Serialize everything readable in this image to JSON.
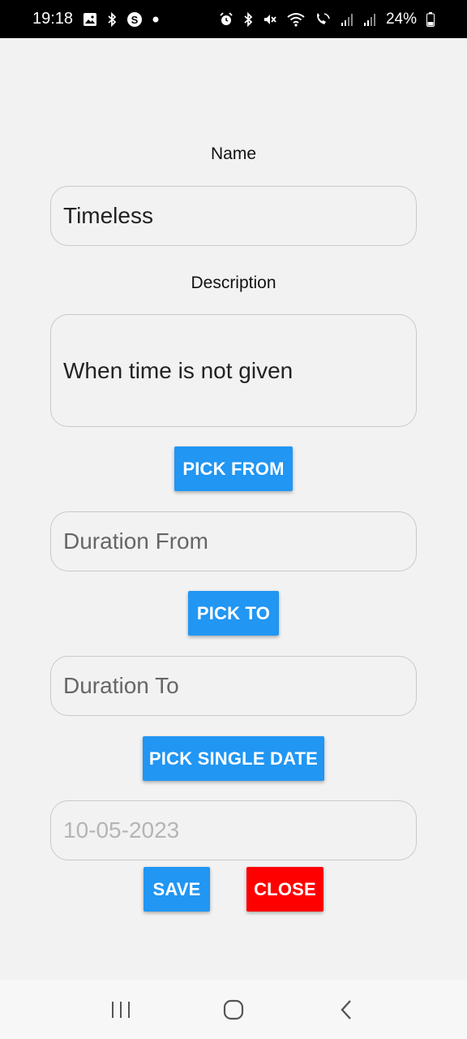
{
  "status_bar": {
    "time": "19:18",
    "battery": "24%",
    "left_icons": [
      "gallery-icon",
      "bluetooth-icon",
      "s-app-icon",
      "dot-icon"
    ],
    "right_icons": [
      "alarm-icon",
      "bluetooth-icon",
      "mute-icon",
      "wifi-icon",
      "call-icon",
      "signal-icon",
      "signal-icon",
      "battery-icon"
    ]
  },
  "form": {
    "name_label": "Name",
    "name_value": "Timeless",
    "description_label": "Description",
    "description_value": "When time is not given",
    "pick_from_label": "PICK FROM",
    "duration_from_placeholder": "Duration From",
    "pick_to_label": "PICK TO",
    "duration_to_placeholder": "Duration To",
    "pick_single_date_label": "PICK SINGLE DATE",
    "single_date_hint": "10-05-2023",
    "save_label": "SAVE",
    "close_label": "CLOSE"
  },
  "colors": {
    "primary_button": "#2196f3",
    "close_button": "#ff0000",
    "background": "#f2f2f2"
  },
  "nav_bar": {
    "buttons": [
      "recents-icon",
      "home-icon",
      "back-icon"
    ]
  }
}
